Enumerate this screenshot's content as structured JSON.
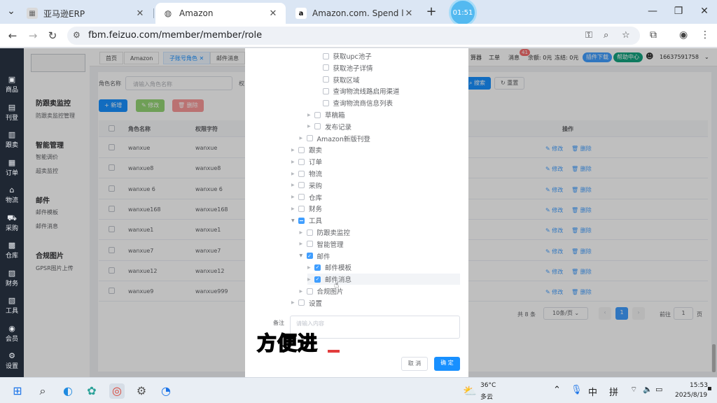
{
  "browser": {
    "tabs": [
      {
        "title": "亚马逊ERP",
        "icon": "app-icon"
      },
      {
        "title": "Amazon",
        "icon": "globe-icon"
      },
      {
        "title": "Amazon.com. Spend less. Sm",
        "icon": "amazon-icon"
      }
    ],
    "timer": "01:51",
    "url": "fbm.feizuo.com/member/member/role"
  },
  "sidenav": [
    {
      "icon": "▣",
      "label": "商品"
    },
    {
      "icon": "▤",
      "label": "刊登"
    },
    {
      "icon": "▥",
      "label": "跟卖"
    },
    {
      "icon": "▦",
      "label": "订单"
    },
    {
      "icon": "⌂",
      "label": "物流"
    },
    {
      "icon": "⛟",
      "label": "采购"
    },
    {
      "icon": "▩",
      "label": "仓库"
    },
    {
      "icon": "▨",
      "label": "财务"
    },
    {
      "icon": "▧",
      "label": "工具"
    },
    {
      "icon": "◉",
      "label": "会员"
    },
    {
      "icon": "⚙",
      "label": "设置"
    }
  ],
  "submenu": {
    "groups": [
      {
        "title": "防跟卖监控",
        "items": [
          "防跟卖监控管理"
        ]
      },
      {
        "title": "智能管理",
        "items": [
          "智能调价",
          "超卖监控"
        ]
      },
      {
        "title": "邮件",
        "items": [
          "邮件模板",
          "邮件消息"
        ]
      },
      {
        "title": "合规图片",
        "items": [
          "GPSR图片上传"
        ]
      }
    ]
  },
  "header": {
    "page_tabs": [
      "首页",
      "Amazon",
      "子账号角色",
      "邮件消息"
    ],
    "calc": "算器",
    "tools": "工单",
    "messages": "消息",
    "msg_count": "41",
    "balance": "余额: 0元",
    "frozen": "冻结: 0元",
    "plugin": "插件下载",
    "help": "帮助中心",
    "phone": "16637591758"
  },
  "filter": {
    "role_name_label": "角色名称",
    "role_name_placeholder": "请输入角色名称",
    "perm_label": "权",
    "search": "搜索",
    "reset": "重置",
    "add": "新增",
    "edit": "修改",
    "delete": "删除"
  },
  "table": {
    "headers": [
      "角色名称",
      "权限字符",
      "操作"
    ],
    "edit_label": "修改",
    "delete_label": "删除",
    "rows": [
      {
        "name": "wanxue",
        "perm": "wanxue"
      },
      {
        "name": "wanxue8",
        "perm": "wanxue8"
      },
      {
        "name": "wanxue 6",
        "perm": "wanxue 6"
      },
      {
        "name": "wanxue168",
        "perm": "wanxue168"
      },
      {
        "name": "wanxue1",
        "perm": "wanxue1"
      },
      {
        "name": "wanxue7",
        "perm": "wanxue7"
      },
      {
        "name": "wanxue12",
        "perm": "wanxue12"
      },
      {
        "name": "wanxue9",
        "perm": "wanxue999"
      }
    ]
  },
  "pager": {
    "total": "共 8 条",
    "page_size": "10条/页",
    "current": "1",
    "goto": "前往",
    "goto_value": "1",
    "page_unit": "页"
  },
  "dialog": {
    "tree": [
      {
        "label": "获取upc池子",
        "level": 3,
        "arrow": false,
        "state": "off"
      },
      {
        "label": "获取池子详情",
        "level": 3,
        "arrow": false,
        "state": "off"
      },
      {
        "label": "获取区域",
        "level": 3,
        "arrow": false,
        "state": "off"
      },
      {
        "label": "查询物流线路启用渠道",
        "level": 3,
        "arrow": false,
        "state": "off"
      },
      {
        "label": "查询物流商信息列表",
        "level": 3,
        "arrow": false,
        "state": "off"
      },
      {
        "label": "草稿箱",
        "level": 2,
        "arrow": true,
        "state": "off"
      },
      {
        "label": "发布记录",
        "level": 2,
        "arrow": true,
        "state": "off"
      },
      {
        "label": "Amazon新版刊登",
        "level": 1,
        "arrow": true,
        "state": "off"
      },
      {
        "label": "跟卖",
        "level": 0,
        "arrow": true,
        "state": "off"
      },
      {
        "label": "订单",
        "level": 0,
        "arrow": true,
        "state": "off"
      },
      {
        "label": "物流",
        "level": 0,
        "arrow": true,
        "state": "off"
      },
      {
        "label": "采购",
        "level": 0,
        "arrow": true,
        "state": "off"
      },
      {
        "label": "仓库",
        "level": 0,
        "arrow": true,
        "state": "off"
      },
      {
        "label": "财务",
        "level": 0,
        "arrow": true,
        "state": "off"
      },
      {
        "label": "工具",
        "level": 0,
        "arrow": true,
        "open": true,
        "state": "half"
      },
      {
        "label": "防跟卖监控",
        "level": 1,
        "arrow": true,
        "state": "off"
      },
      {
        "label": "智能管理",
        "level": 1,
        "arrow": true,
        "state": "off"
      },
      {
        "label": "邮件",
        "level": 1,
        "arrow": true,
        "open": true,
        "state": "on"
      },
      {
        "label": "邮件模板",
        "level": 2,
        "arrow": true,
        "state": "on"
      },
      {
        "label": "邮件消息",
        "level": 2,
        "arrow": true,
        "state": "on",
        "highlight": true
      },
      {
        "label": "合规图片",
        "level": 1,
        "arrow": true,
        "state": "off"
      },
      {
        "label": "设置",
        "level": 0,
        "arrow": true,
        "state": "off"
      }
    ],
    "remark_label": "备注",
    "remark_placeholder": "请输入内容",
    "cancel": "取 消",
    "confirm": "确 定"
  },
  "caption": "方便进",
  "taskbar": {
    "weather_temp": "36°C",
    "weather_desc": "多云",
    "ime1": "中",
    "ime2": "拼",
    "time": "15:53",
    "date": "2025/8/19"
  }
}
